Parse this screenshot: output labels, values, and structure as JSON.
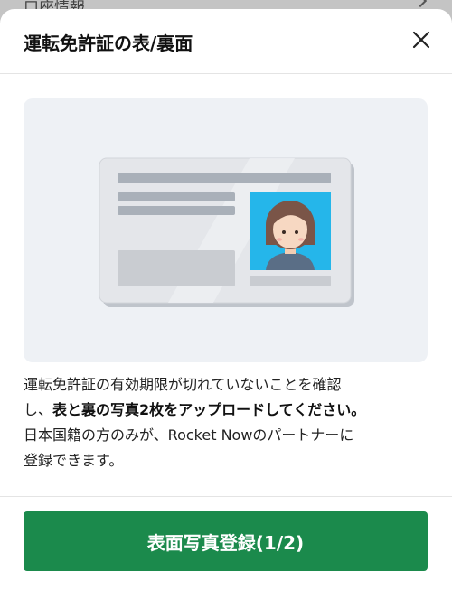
{
  "background_row": {
    "label": "口座情報"
  },
  "sheet": {
    "title": "運転免許証の表/裏面",
    "close_icon": "close-icon"
  },
  "illustration": {
    "icon": "drivers-license-card-illustration",
    "photo_color": "#25b6ea"
  },
  "description": {
    "line1": "運転免許証の有効期限が切れていないことを確認",
    "line2_prefix": "し、",
    "line2_bold": "表と裏の写真2枚をアップロードしてください。",
    "line3": "日本国籍の方のみが、Rocket Nowのパートナーに",
    "line4": "登録できます。"
  },
  "primary_button": {
    "label": "表面写真登録(1/2)",
    "color": "#1b8a4c"
  }
}
